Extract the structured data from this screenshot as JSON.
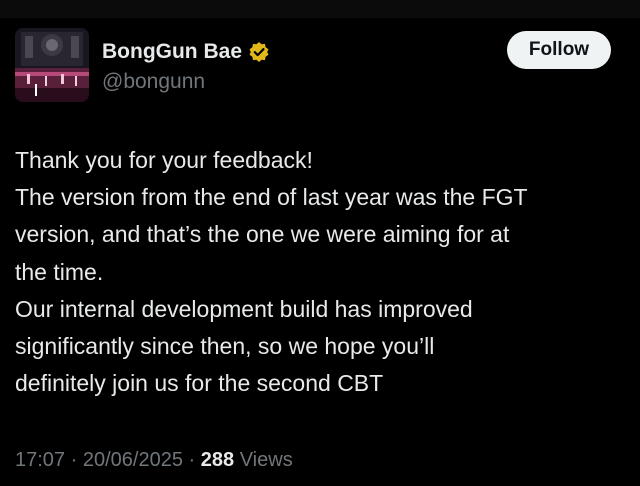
{
  "author": {
    "display_name": "BongGun Bae",
    "handle": "@bongunn",
    "verified": true,
    "verified_icon": "verified-badge-icon",
    "avatar_icon": "avatar-stage-image"
  },
  "follow_button": {
    "label": "Follow"
  },
  "tweet": {
    "lines": [
      "Thank you for your feedback!",
      "The version from the end of last year was the FGT",
      "version, and that’s the one we were aiming for at",
      "the time.",
      "Our internal development build has improved",
      "significantly since then, so we hope you’ll",
      "definitely join us for the second CBT"
    ]
  },
  "meta": {
    "time": "17:07",
    "separator": "·",
    "date": "20/06/2025",
    "views_count": "288",
    "views_label": "Views"
  },
  "colors": {
    "background": "#000000",
    "primary_text": "#e7e9ea",
    "secondary_text": "#71767b",
    "follow_bg": "#eff3f4",
    "verified_gold": "#e2b719"
  }
}
